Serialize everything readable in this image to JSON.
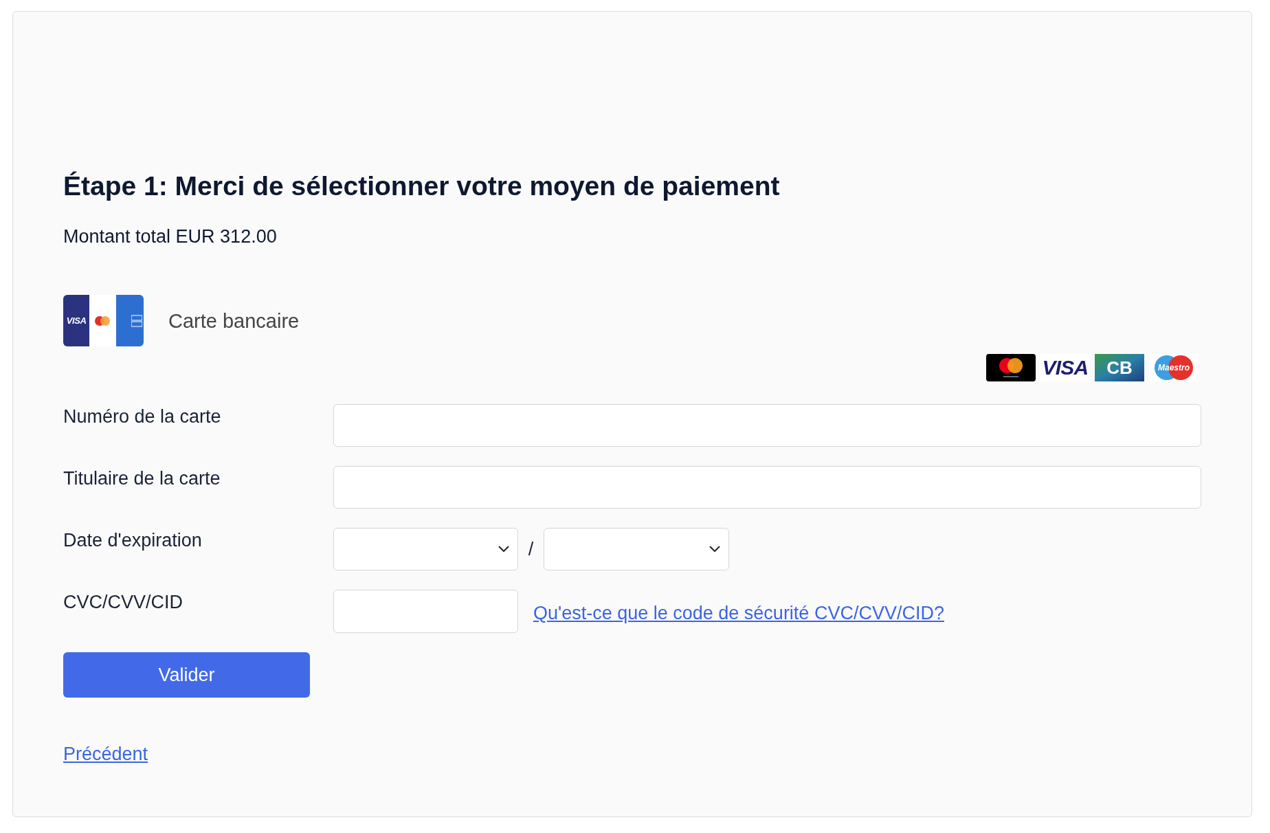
{
  "heading": "Étape 1: Merci de sélectionner votre moyen de paiement",
  "total": "Montant total EUR 312.00",
  "payment_method": {
    "logo": [
      {
        "kind": "visa",
        "label": "VISA"
      },
      {
        "kind": "mastercard"
      },
      {
        "kind": "amex"
      }
    ],
    "label": "Carte bancaire"
  },
  "accepted_cards": [
    {
      "kind": "mastercard"
    },
    {
      "kind": "visa",
      "label": "VISA"
    },
    {
      "kind": "cb",
      "label": "CB"
    },
    {
      "kind": "maestro",
      "label": "Maestro"
    }
  ],
  "fields": [
    {
      "kind": "text",
      "label": "Numéro de la carte"
    },
    {
      "kind": "text",
      "label": "Titulaire de la carte"
    },
    {
      "kind": "expiry",
      "label": "Date d'expiration",
      "separator": "/"
    },
    {
      "kind": "cvc",
      "label": "CVC/CVV/CID",
      "help_link": "Qu'est-ce que le code de sécurité CVC/CVV/CID?"
    }
  ],
  "submit_button": "Valider",
  "back_link": "Précédent"
}
